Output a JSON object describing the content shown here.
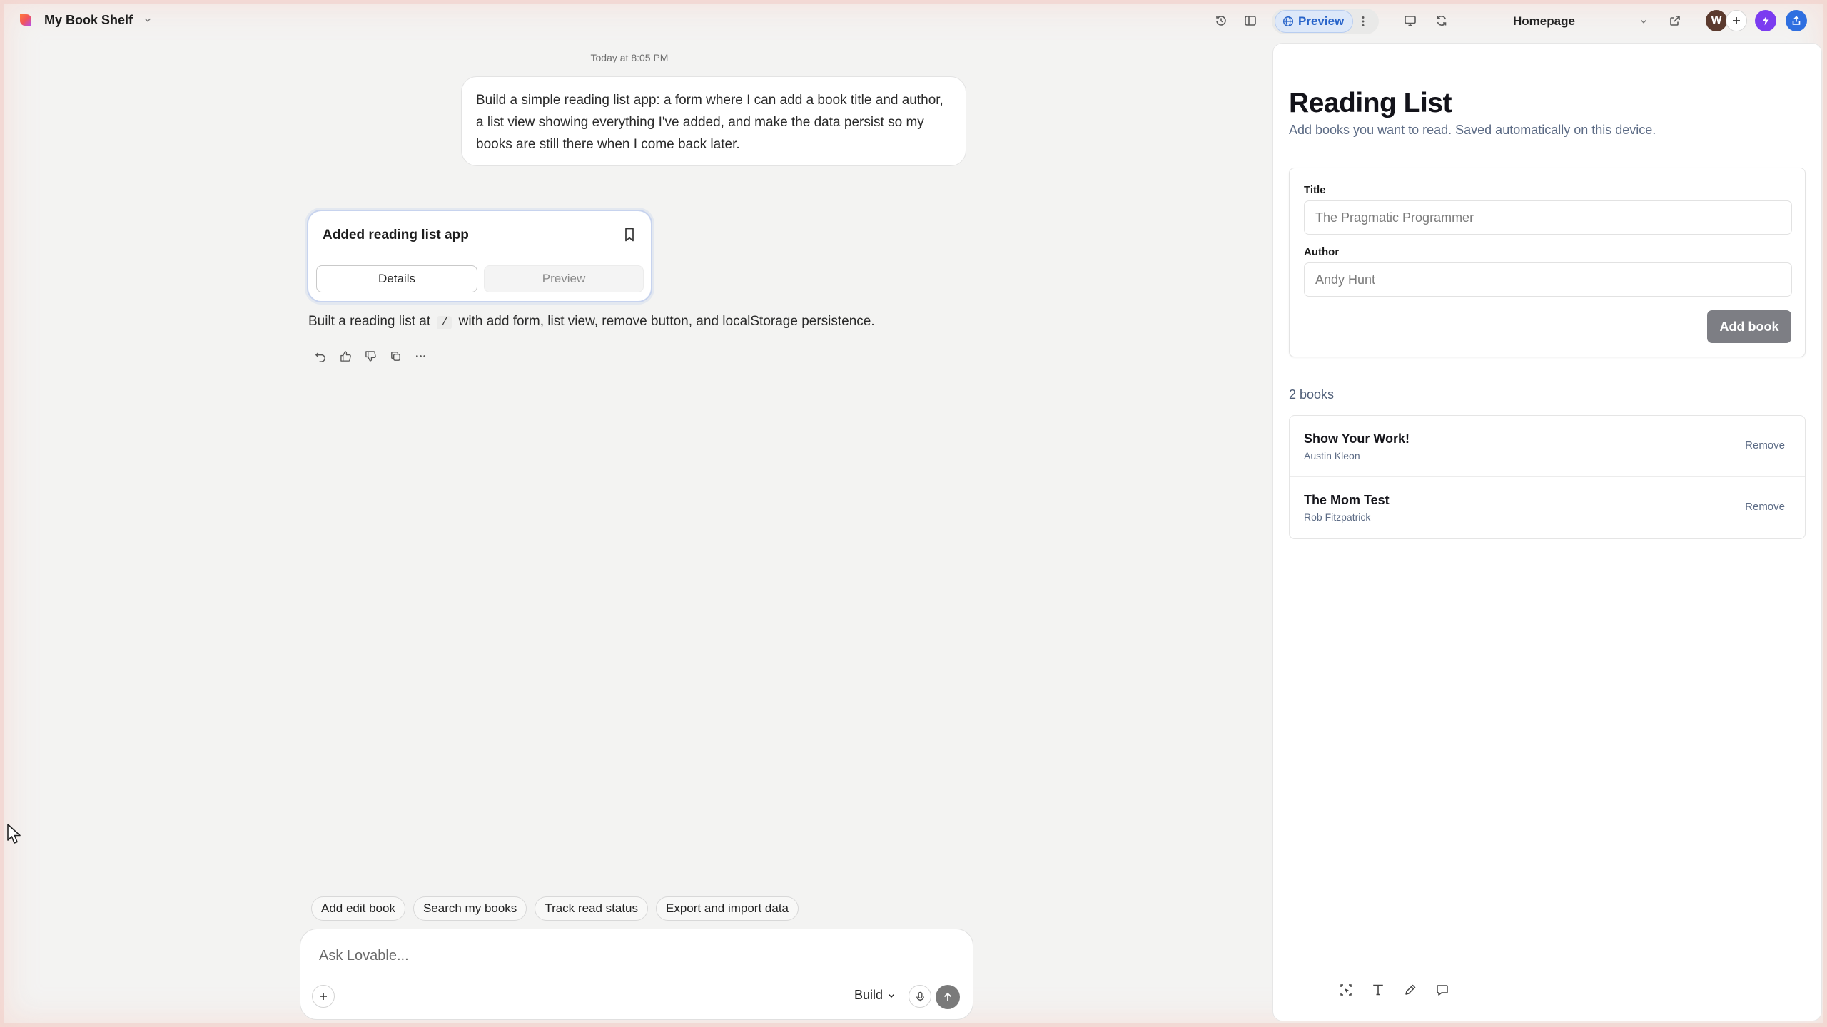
{
  "app": {
    "project_name": "My Book Shelf",
    "preview_label": "Preview",
    "route": "Homepage",
    "avatar_initial": "W",
    "accent_color": "#2763c9",
    "brand_color": "#f2555a"
  },
  "chat": {
    "timestamp": "Today at 8:05 PM",
    "user_message": "Build a simple reading list app: a form where I can add a book title and author, a list view showing everything I've added, and make the data persist so my books are still there when I come back later.",
    "card": {
      "title": "Added reading list app",
      "tab_details": "Details",
      "tab_preview": "Preview"
    },
    "summary_before": "Built a reading list at",
    "summary_code": "/",
    "summary_after": "with add form, list view, remove button, and localStorage persistence.",
    "actions": [
      "undo-icon",
      "thumbs-up-icon",
      "thumbs-down-icon",
      "copy-icon",
      "more-icon"
    ],
    "suggestions": [
      "Add edit book",
      "Search my books",
      "Track read status",
      "Export and import data"
    ],
    "composer": {
      "placeholder": "Ask Lovable...",
      "mode": "Build"
    }
  },
  "preview": {
    "title": "Reading List",
    "subtitle": "Add books you want to read. Saved automatically on this device.",
    "form": {
      "title_label": "Title",
      "title_placeholder": "The Pragmatic Programmer",
      "author_label": "Author",
      "author_placeholder": "Andy Hunt",
      "submit_label": "Add book"
    },
    "count_label": "2 books",
    "books": [
      {
        "title": "Show Your Work!",
        "author": "Austin Kleon",
        "remove_label": "Remove"
      },
      {
        "title": "The Mom Test",
        "author": "Rob Fitzpatrick",
        "remove_label": "Remove"
      }
    ],
    "edit_tools": [
      "select-element-icon",
      "text-edit-icon",
      "draw-icon",
      "comment-icon"
    ]
  }
}
